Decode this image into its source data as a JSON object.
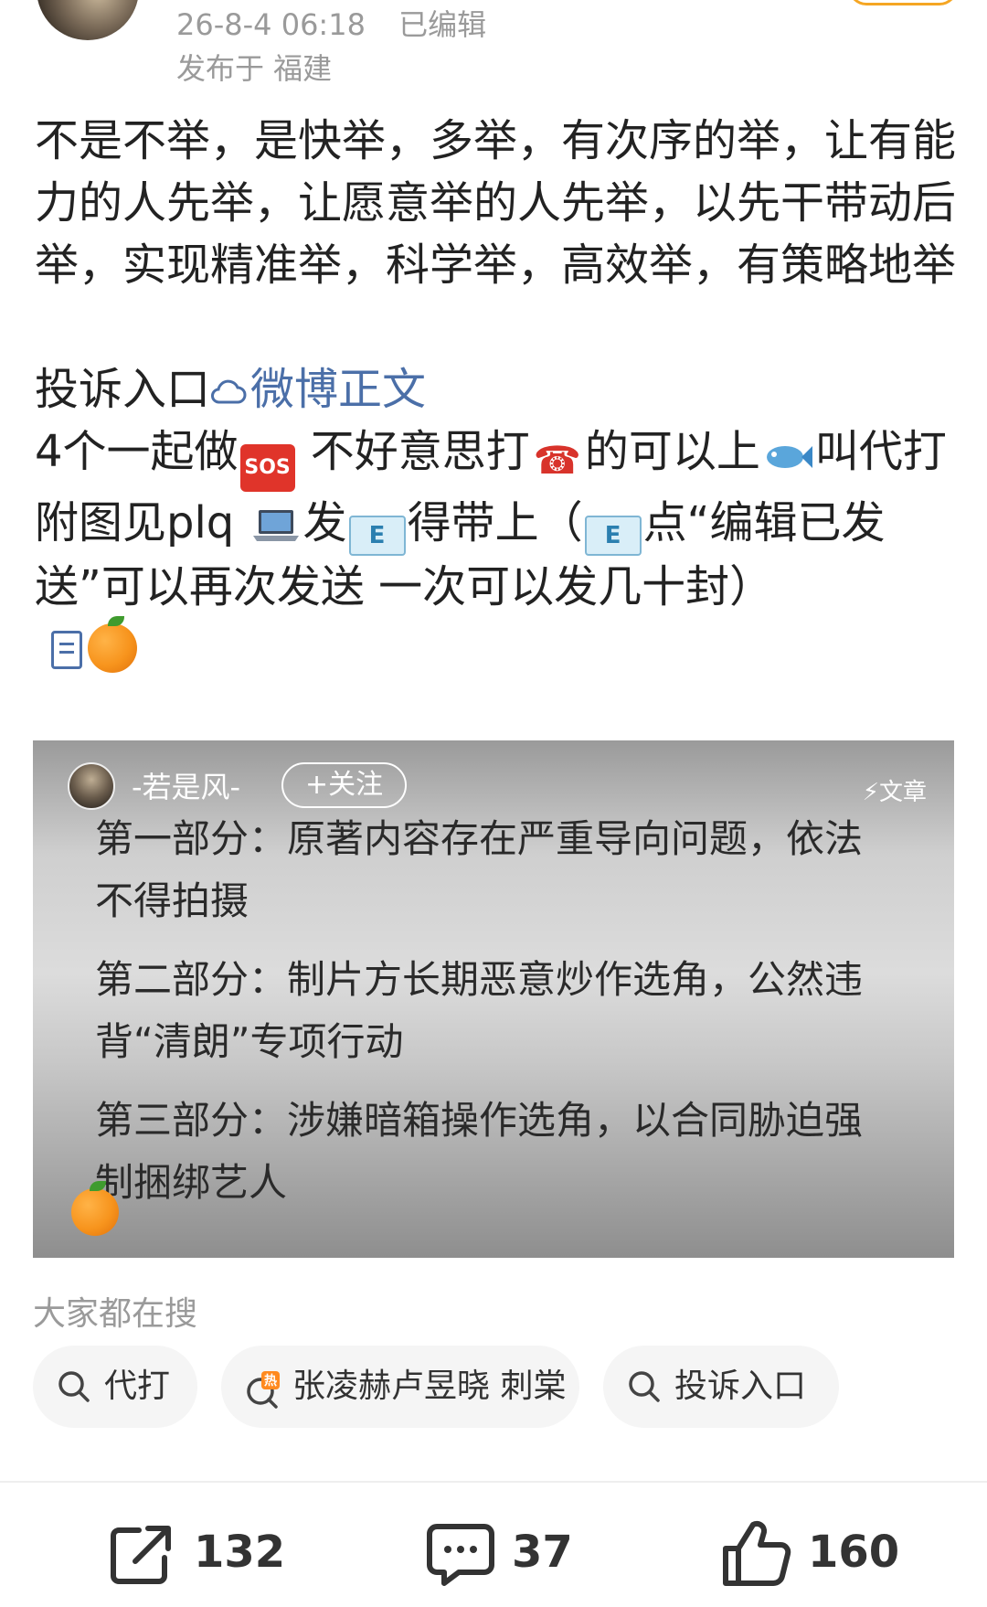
{
  "header": {
    "timestamp": "26-8-4 06:18",
    "edited": "已编辑",
    "location": "发布于 福建"
  },
  "post": {
    "para1": "不是不举，是快举，多举，有次序的举，让有能力的人先举，让愿意举的人先举，以先干带动后举，实现精准举，科学举，高效举，有策略地举",
    "link_prefix": "投诉入口",
    "link_text": "微博正文",
    "line3_a": "4个一起做",
    "sos": "SOS",
    "line3_b": " 不好意思打",
    "line3_c": "的可以上",
    "line3_d": "叫代打 附图见plq ",
    "line3_e": "发",
    "line3_f": "得带上（",
    "line3_g": "点“编辑已发送”可以再次发送 一次可以发几十封）",
    "mail_glyph": "E"
  },
  "card": {
    "author": "-若是风-",
    "follow": "+关注",
    "tag": "⚡文章",
    "sections": [
      "第一部分：原著内容存在严重导向问题，依法不得拍摄",
      "第二部分：制片方长期恶意炒作选角，公然违背“清朗”专项行动",
      "第三部分：涉嫌暗箱操作选角，以合同胁迫强制捆绑艺人"
    ]
  },
  "search": {
    "title": "大家都在搜",
    "chips": [
      "代打",
      "张凌赫卢昱晓 刺棠",
      "投诉入口"
    ]
  },
  "actions": {
    "repost": "132",
    "comment": "37",
    "like": "160"
  },
  "colors": {
    "link": "#4b6fa8",
    "meta": "#9a9a9a",
    "chip_bg": "#f5f5f5"
  }
}
